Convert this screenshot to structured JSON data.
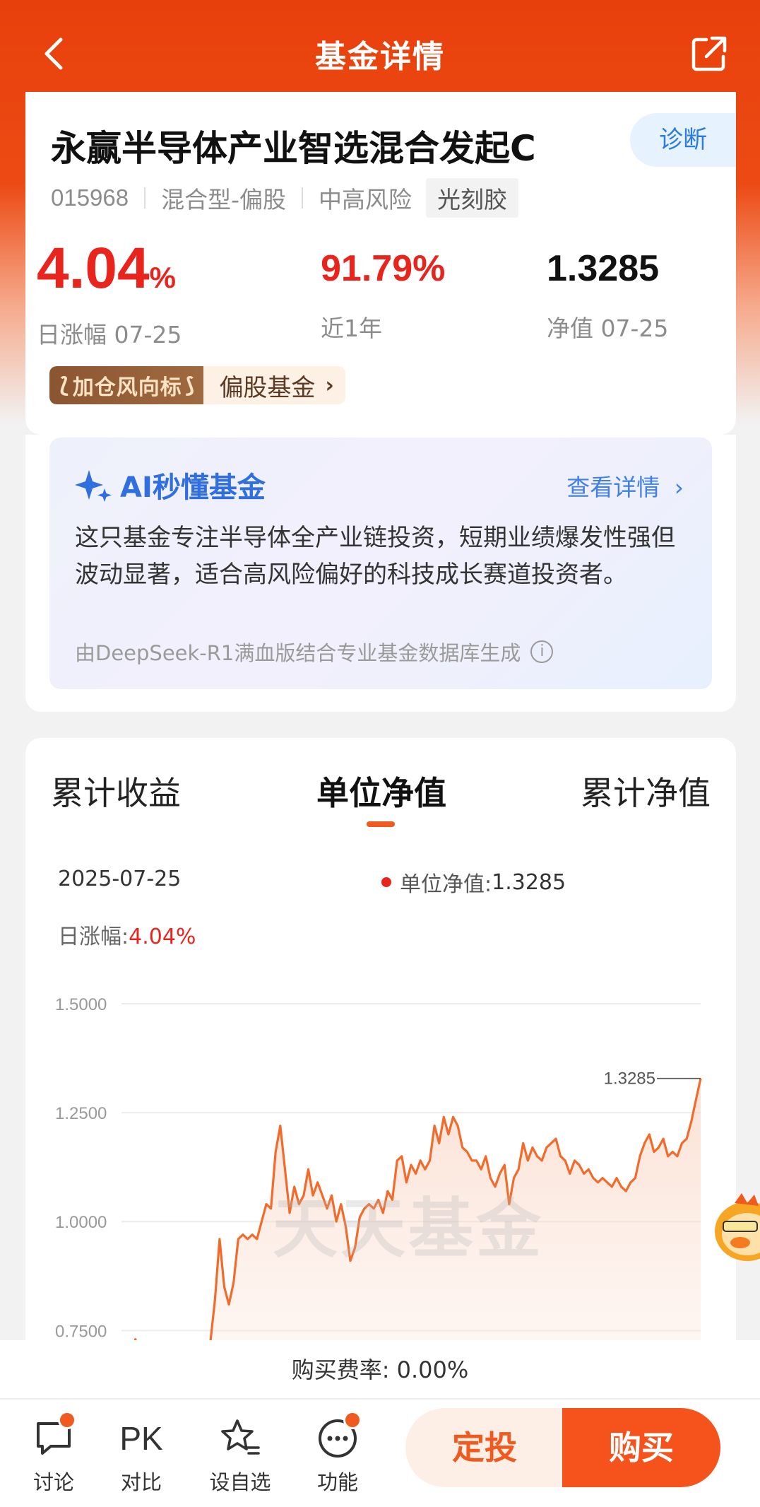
{
  "nav": {
    "title": "基金详情"
  },
  "fund": {
    "name": "永赢半导体产业智选混合发起C",
    "diagnose_label": "诊断",
    "code": "015968",
    "type": "混合型-偏股",
    "risk": "中高风险",
    "theme": "光刻胶"
  },
  "stats": {
    "day_change_value": "4.04",
    "day_change_unit": "%",
    "day_change_label": "日涨幅 07-25",
    "year_return_value": "91.79%",
    "year_return_label": "近1年",
    "nav_value": "1.3285",
    "nav_label": "净值 07-25"
  },
  "wind_vane": {
    "badge": "加仓风向标",
    "text": "偏股基金"
  },
  "ai": {
    "title": "AI秒懂基金",
    "more": "查看详情",
    "body": "这只基金专注半导体全产业链投资，短期业绩爆发性强但波动显著，适合高风险偏好的科技成长赛道投资者。",
    "footnote": "由DeepSeek-R1满血版结合专业基金数据库生成"
  },
  "chart_tabs": [
    "累计收益",
    "单位净值",
    "累计净值"
  ],
  "chart_info": {
    "date": "2025-07-25",
    "nav_label": "单位净值:",
    "nav_value": "1.3285",
    "change_label": "日涨幅:",
    "change_value": "4.04%",
    "end_label": "1.3285",
    "watermark": "天天基金"
  },
  "chart_data": {
    "type": "area",
    "ylim": [
      0.65,
      1.5
    ],
    "yticks": [
      "1.5000",
      "1.2500",
      "1.0000",
      "0.7500"
    ],
    "ytick_values": [
      1.5,
      1.25,
      1.0,
      0.75
    ],
    "series": [
      {
        "values": [
          0.69,
          0.7,
          0.7,
          0.73,
          0.68,
          0.68,
          0.67,
          0.67,
          0.66,
          0.64,
          0.62,
          0.66,
          0.64,
          0.65,
          0.64,
          0.64,
          0.65,
          0.64,
          0.66,
          0.72,
          0.82,
          0.96,
          0.85,
          0.81,
          0.86,
          0.96,
          0.97,
          0.96,
          0.97,
          0.96,
          1.0,
          1.04,
          1.03,
          1.16,
          1.22,
          1.12,
          1.02,
          1.08,
          1.04,
          1.06,
          1.12,
          1.06,
          1.09,
          1.06,
          1.03,
          1.06,
          1.0,
          1.04,
          0.99,
          0.91,
          0.94,
          1.01,
          1.03,
          1.04,
          1.03,
          1.05,
          1.02,
          1.07,
          1.05,
          1.14,
          1.15,
          1.09,
          1.13,
          1.11,
          1.14,
          1.12,
          1.14,
          1.22,
          1.18,
          1.24,
          1.2,
          1.24,
          1.22,
          1.17,
          1.16,
          1.14,
          1.14,
          1.12,
          1.15,
          1.1,
          1.08,
          1.11,
          1.13,
          1.04,
          1.1,
          1.12,
          1.18,
          1.14,
          1.17,
          1.15,
          1.14,
          1.17,
          1.18,
          1.19,
          1.15,
          1.14,
          1.11,
          1.14,
          1.13,
          1.11,
          1.12,
          1.1,
          1.09,
          1.1,
          1.09,
          1.08,
          1.1,
          1.08,
          1.07,
          1.09,
          1.1,
          1.15,
          1.18,
          1.2,
          1.16,
          1.17,
          1.19,
          1.15,
          1.16,
          1.15,
          1.18,
          1.19,
          1.23,
          1.28,
          1.3285
        ]
      }
    ]
  },
  "fee": {
    "text": "购买费率: 0.00%"
  },
  "bottom": {
    "discuss": "讨论",
    "pk_icon": "PK",
    "compare": "对比",
    "watchlist": "设自选",
    "functions": "功能",
    "sip": "定投",
    "buy": "购买"
  }
}
